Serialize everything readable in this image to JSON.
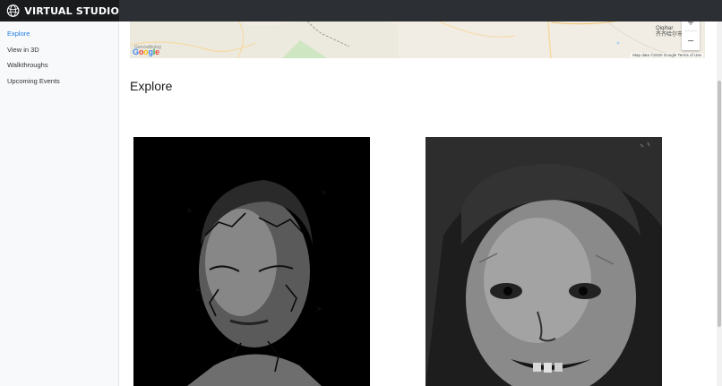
{
  "app": {
    "brand": "VIRTUAL STUDIO"
  },
  "sidebar": {
    "items": [
      {
        "label": "Explore",
        "active": true
      },
      {
        "label": "View in 3D",
        "active": false
      },
      {
        "label": "Walkthroughs",
        "active": false
      },
      {
        "label": "Upcoming Events",
        "active": false
      }
    ]
  },
  "map": {
    "logo_letters": [
      "G",
      "o",
      "o",
      "g",
      "l",
      "e"
    ],
    "place_label": "Ganzadbulag",
    "city_latin": "Qiqihar",
    "city_local": "齐齐哈尔市",
    "attribution": "Map data ©2020 Google   Terms of Use",
    "zoom_in": "+",
    "zoom_out": "−"
  },
  "main": {
    "title": "Explore"
  },
  "gallery": [
    {
      "name": "woman-with-branch-tattoos-artwork"
    },
    {
      "name": "smiling-child-sketch-artwork"
    }
  ],
  "colors": {
    "accent": "#1e7de6",
    "topbar": "#2c2f33",
    "sidebar_bg": "#f8f9fa"
  }
}
